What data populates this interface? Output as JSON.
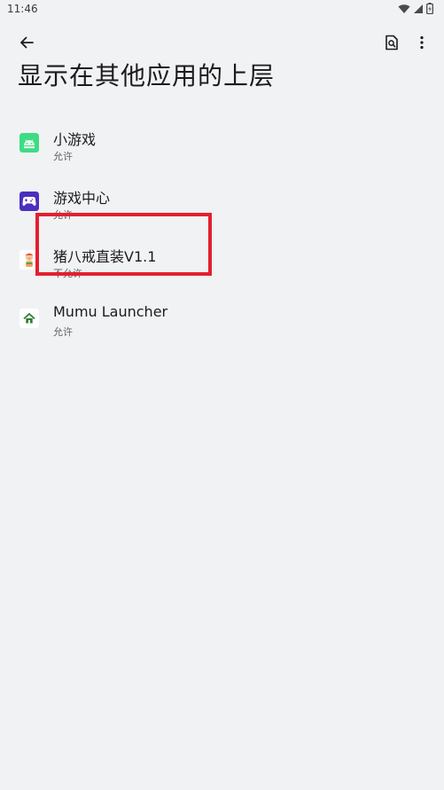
{
  "status_bar": {
    "time": "11:46",
    "icons": [
      "wifi-icon",
      "signal-icon",
      "battery-icon"
    ]
  },
  "toolbar": {
    "back_icon": "arrow-back-icon",
    "search_icon": "search-in-page-icon",
    "more_icon": "more-vertical-icon"
  },
  "page": {
    "title": "显示在其他应用的上层"
  },
  "apps": [
    {
      "name": "小游戏",
      "status": "允许",
      "icon": "android-icon",
      "icon_color": "#3ddc84"
    },
    {
      "name": "游戏中心",
      "status": "允许",
      "icon": "gamepad-icon",
      "icon_color": "#4b2fbf"
    },
    {
      "name": "猪八戒直装V1.1",
      "status": "不允许",
      "icon": "pig-app-icon",
      "icon_color": "#f3a35b"
    },
    {
      "name": "Mumu Launcher",
      "status": "允许",
      "icon": "home-icon",
      "icon_color": "#2e7d32"
    }
  ],
  "colors": {
    "background": "#f1f2f4",
    "highlight": "#e3202f"
  }
}
